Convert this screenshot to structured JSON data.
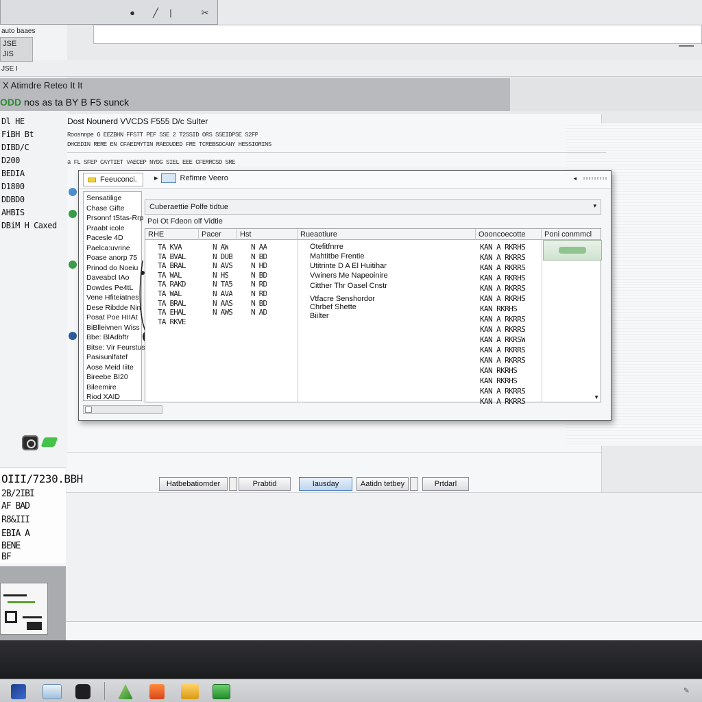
{
  "window": {
    "menu_title": "auto baaes",
    "toolbar_left_label": "JSE\nJIS",
    "toolbar_mid_label": "JSE I",
    "header_line1": "X Atimdre Reteo It It",
    "header_line2_prefix": "ODD",
    "header_line2": "nos as ta BY B F5 sunck",
    "doc_title": "Dost Nounerd VVCDS F555 D/c Sulter"
  },
  "left_list": [
    "Dl HE",
    "FiBH Bt",
    "DIBD/C",
    "D200",
    "BEDIA",
    "D1800",
    "DDBD0",
    "AHBIS",
    "DBiM H Caxed"
  ],
  "noise_lines": [
    "Roosnnpe G EEZBHN FFS7T PEF SSE 2 T2SSID ORS SSEIDPSE S2FP",
    "DHCEDIN RERE EN CFAEIMYTIN RAEDUDED FRE TCREBSDCANY HESSIORINS",
    "a FL SFEP CAYTIET VAECEP NYDG SIEL EEE CFERRCSD SRE"
  ],
  "dialog": {
    "tab_label": "Feeuconci.",
    "title": "Refimre Veero",
    "filter_text": "Cuberaettie Polfe tidtue",
    "filter_label": "Poi Ot Fdeon olf Vidtie",
    "left_items": [
      "Sensatilige",
      "Chase Gifte",
      "Prsonnf tStas-Rrp",
      "Praabt icole",
      "Pacesle 4D",
      "Paelca:uvrine",
      "Poase anorp 75",
      "Prinod do Noeiu",
      "Daveabcl IAo",
      "Dowdes Pe4tL",
      "Vene Hfiteiatnes",
      "Dese Ribdde Nin",
      "Posat Poe HIIAt",
      "BiBlleivnen Wiss",
      "Bbe: BlAdbftr",
      "Bitse: Vir Feurstus",
      "Pasisunlfatef",
      "Aose Meid Iiite",
      "Bireebe BI20",
      "Bileemire",
      "Riod XAID"
    ],
    "columns": [
      "RHE",
      "Pacer",
      "Hst",
      "Rueaotiure",
      "Oooncoecotte",
      "Poni conmmcl"
    ],
    "col1": [
      "TA KVA",
      "TA BVAL",
      "TA BRAL",
      "TA WAL",
      "TA RAKD",
      "TA WAL",
      "TA BRAL",
      "TA EHAL",
      "TA RKVE"
    ],
    "col2": [
      "N AW",
      "N DUB",
      "N AVS",
      "N HS",
      "N TA5",
      "N AVA",
      "N AAS",
      "N AWS"
    ],
    "col3": [
      "N AA",
      "N BD",
      "N HD",
      "N BD",
      "N RD",
      "N RD",
      "N BD",
      "N AD"
    ],
    "descriptions": [
      "Otefitfnrre",
      "Mahtitbe Frentie",
      "Utitrinte D A El Huitihar",
      "Vwiners Me Napeoinire",
      "Citther Thr Oasel Cnstr",
      "Vtfacre Senshordor",
      "Chrbef Shette",
      "Biilter"
    ],
    "statuses": [
      "KAN A RKRHS",
      "KAN A RKRRS",
      "KAN A RKRRS",
      "KAN A RKRHS",
      "KAN A RKRRS",
      "KAN A RKRHS",
      "KAN RKRHS",
      "KAN A RKRRS",
      "KAN A RKRRS",
      "KAN A RKRSW",
      "KAN A RKRRS",
      "KAN A RKRRS",
      "KAN RKRHS",
      "KAN RKRHS",
      "KAN A RKRRS",
      "KAN A RKRRS"
    ]
  },
  "buttons": [
    "Hatbebatiomder",
    "Prabtid",
    "Iausday",
    "Aatidn tetbey",
    "Prtdarl"
  ],
  "lower_left": [
    "OIII/7230.BBH",
    "2B/2IBI",
    "AF BAD",
    "R8&III",
    "EBIA A",
    "BENE",
    "BF"
  ],
  "colors": {
    "accent": "#4f83bd",
    "brand_green": "#2f8a36",
    "header_grey": "#b8babd"
  },
  "taskbar_icons": [
    "start-icon",
    "window-icon",
    "cube-icon",
    "mountain-icon",
    "orange-app-icon",
    "folder-icon",
    "green-app-icon"
  ]
}
